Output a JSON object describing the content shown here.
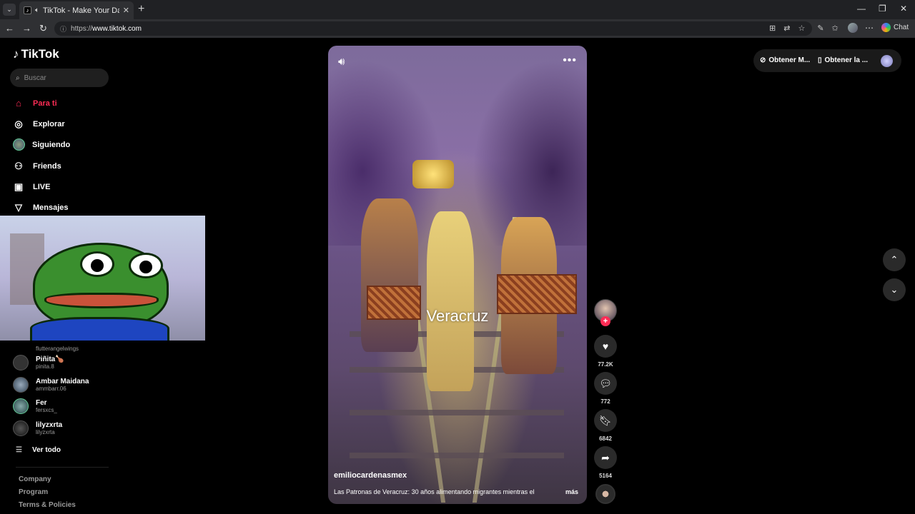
{
  "browser": {
    "tab_title": "TikTok - Make Your Day",
    "url_prefix": "https://",
    "url_domain": "www.tiktok.com",
    "chat_label": "Chat"
  },
  "sidebar": {
    "logo": "TikTok",
    "search_placeholder": "Buscar",
    "nav": [
      {
        "label": "Para ti",
        "icon": "home-icon"
      },
      {
        "label": "Explorar",
        "icon": "compass-icon"
      },
      {
        "label": "Siguiendo",
        "icon": "following-avatar"
      },
      {
        "label": "Friends",
        "icon": "friends-icon"
      },
      {
        "label": "LIVE",
        "icon": "live-icon"
      },
      {
        "label": "Mensajes",
        "icon": "send-icon"
      }
    ],
    "following_accounts": [
      {
        "name": "",
        "handle": "flutterangelwings"
      },
      {
        "name": "Piñita🍗",
        "handle": "pinita.8"
      },
      {
        "name": "Ambar Maidana",
        "handle": "ammbarr.06"
      },
      {
        "name": "Fer",
        "handle": "fersxcs_"
      },
      {
        "name": "lilyzxrta",
        "handle": "lilyzxrta"
      }
    ],
    "see_all": "Ver todo",
    "footer": [
      "Company",
      "Program",
      "Terms & Policies"
    ]
  },
  "video": {
    "overlay_text": "Veracruz",
    "author": "emiliocardenasmex",
    "description": "Las Patronas de Veracruz: 30 años alimentando migrantes mientras el",
    "more": "más"
  },
  "actions": {
    "likes": "77.2K",
    "comments": "772",
    "saves": "6842",
    "shares": "5164"
  },
  "topbar": {
    "get_coins": "Obtener M...",
    "get_app": "Obtener la ..."
  },
  "colors": {
    "accent": "#fe2c55",
    "background": "#000000"
  }
}
